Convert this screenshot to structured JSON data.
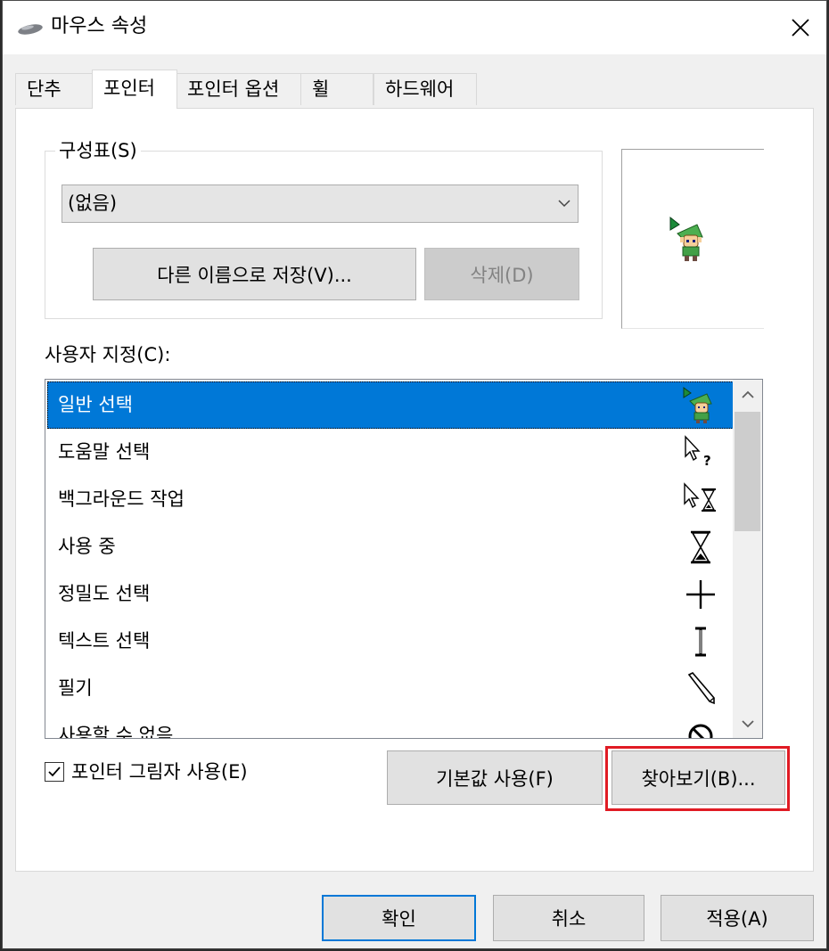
{
  "window": {
    "title": "마우스 속성",
    "close_label": "닫기"
  },
  "tabs": [
    {
      "label": "단추",
      "active": false
    },
    {
      "label": "포인터",
      "active": true
    },
    {
      "label": "포인터 옵션",
      "active": false
    },
    {
      "label": "휠",
      "active": false
    },
    {
      "label": "하드웨어",
      "active": false
    }
  ],
  "scheme": {
    "group_label": "구성표(S)",
    "selected": "(없음)",
    "save_as_label": "다른 이름으로 저장(V)...",
    "delete_label": "삭제(D)"
  },
  "custom": {
    "label": "사용자 지정(C):",
    "items": [
      {
        "label": "일반 선택",
        "icon": "link-sprite-cursor-icon",
        "selected": true
      },
      {
        "label": "도움말 선택",
        "icon": "help-select-cursor-icon",
        "selected": false
      },
      {
        "label": "백그라운드 작업",
        "icon": "working-in-background-cursor-icon",
        "selected": false
      },
      {
        "label": "사용 중",
        "icon": "hourglass-busy-cursor-icon",
        "selected": false
      },
      {
        "label": "정밀도 선택",
        "icon": "crosshair-cursor-icon",
        "selected": false
      },
      {
        "label": "텍스트 선택",
        "icon": "text-beam-cursor-icon",
        "selected": false
      },
      {
        "label": "필기",
        "icon": "pen-handwriting-cursor-icon",
        "selected": false
      },
      {
        "label": "사용할 수 없음",
        "icon": "unavailable-cursor-icon",
        "selected": false
      }
    ]
  },
  "shadow_checkbox": {
    "label": "포인터 그림자 사용(E)",
    "checked": true
  },
  "buttons": {
    "use_default": "기본값 사용(F)",
    "browse": "찾아보기(B)...",
    "ok": "확인",
    "cancel": "취소",
    "apply": "적용(A)"
  },
  "colors": {
    "selection": "#0078d7",
    "highlight_box": "#e01b24",
    "default_button_border": "#0078d7"
  }
}
